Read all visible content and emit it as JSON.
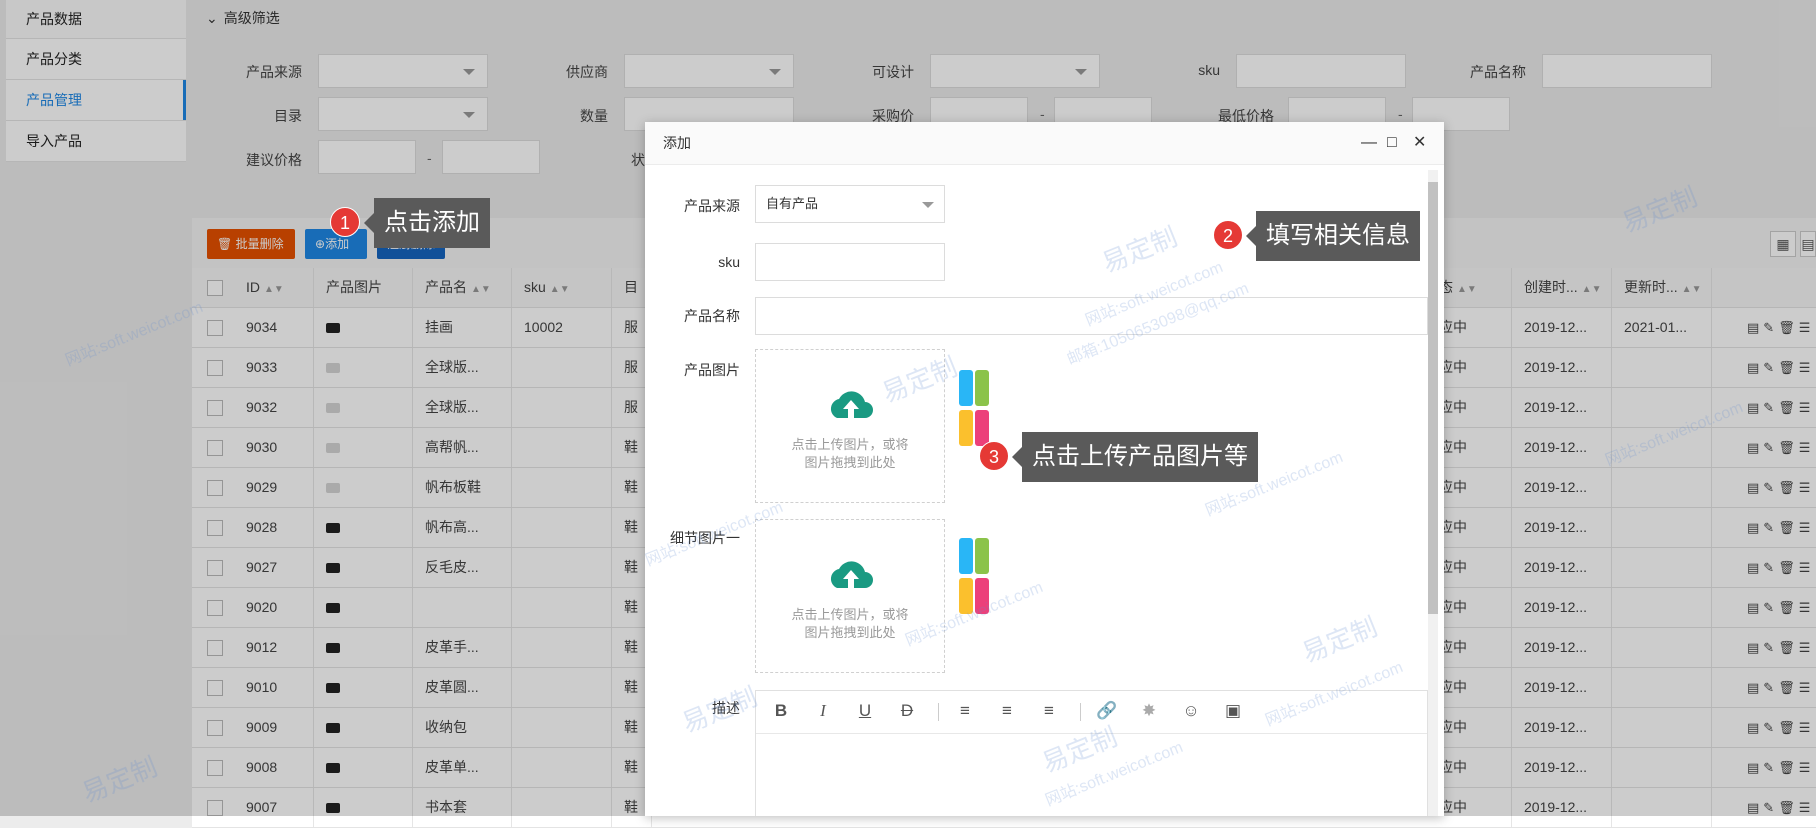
{
  "sidebar": {
    "items": [
      {
        "label": "产品数据"
      },
      {
        "label": "产品分类"
      },
      {
        "label": "产品管理"
      },
      {
        "label": "导入产品"
      }
    ]
  },
  "filter": {
    "title": "高级筛选",
    "fields": {
      "source": "产品来源",
      "supplier": "供应商",
      "designable": "可设计",
      "sku": "sku",
      "name": "产品名称",
      "catalog": "目录",
      "quantity": "数量",
      "purchase_price": "采购价",
      "min_price": "最低价格",
      "suggest_price": "建议价格",
      "status_partial": "状"
    },
    "range_sep": "-"
  },
  "toolbar": {
    "batch_delete": "批量删除",
    "add": "添加",
    "register": "注册删除"
  },
  "table": {
    "headers": [
      "ID",
      "产品图片",
      "产品名",
      "sku",
      "目",
      "态",
      "创建时...",
      "更新时..."
    ],
    "rows": [
      {
        "id": "9034",
        "name": "挂画",
        "sku": "10002",
        "cat": "服",
        "status": "应中",
        "created": "2019-12...",
        "updated": "2021-01...",
        "thumb": "dark"
      },
      {
        "id": "9033",
        "name": "全球版...",
        "sku": "",
        "cat": "服",
        "status": "应中",
        "created": "2019-12...",
        "updated": "",
        "thumb": "light"
      },
      {
        "id": "9032",
        "name": "全球版...",
        "sku": "",
        "cat": "服",
        "status": "应中",
        "created": "2019-12...",
        "updated": "",
        "thumb": "light"
      },
      {
        "id": "9030",
        "name": "高帮帆...",
        "sku": "",
        "cat": "鞋",
        "status": "应中",
        "created": "2019-12...",
        "updated": "",
        "thumb": "light"
      },
      {
        "id": "9029",
        "name": "帆布板鞋",
        "sku": "",
        "cat": "鞋",
        "status": "应中",
        "created": "2019-12...",
        "updated": "",
        "thumb": "light"
      },
      {
        "id": "9028",
        "name": "帆布高...",
        "sku": "",
        "cat": "鞋",
        "status": "应中",
        "created": "2019-12...",
        "updated": "",
        "thumb": "dark"
      },
      {
        "id": "9027",
        "name": "反毛皮...",
        "sku": "",
        "cat": "鞋",
        "status": "应中",
        "created": "2019-12...",
        "updated": "",
        "thumb": "dark"
      },
      {
        "id": "9020",
        "name": "",
        "sku": "",
        "cat": "鞋",
        "status": "应中",
        "created": "2019-12...",
        "updated": "",
        "thumb": "dark"
      },
      {
        "id": "9012",
        "name": "皮革手...",
        "sku": "",
        "cat": "鞋",
        "status": "应中",
        "created": "2019-12...",
        "updated": "",
        "thumb": "dark"
      },
      {
        "id": "9010",
        "name": "皮革圆...",
        "sku": "",
        "cat": "鞋",
        "status": "应中",
        "created": "2019-12...",
        "updated": "",
        "thumb": "dark"
      },
      {
        "id": "9009",
        "name": "收纳包",
        "sku": "",
        "cat": "鞋",
        "status": "应中",
        "created": "2019-12...",
        "updated": "",
        "thumb": "dark"
      },
      {
        "id": "9008",
        "name": "皮革单...",
        "sku": "",
        "cat": "鞋",
        "status": "应中",
        "created": "2019-12...",
        "updated": "",
        "thumb": "dark"
      },
      {
        "id": "9007",
        "name": "书本套",
        "sku": "",
        "cat": "鞋",
        "status": "应中",
        "created": "2019-12...",
        "updated": "",
        "thumb": "dark"
      }
    ]
  },
  "dialog": {
    "title": "添加",
    "fields": {
      "source_label": "产品来源",
      "source_value": "自有产品",
      "sku_label": "sku",
      "name_label": "产品名称",
      "image_label": "产品图片",
      "detail_label": "细节图片一",
      "desc_label": "描述"
    },
    "upload_hint_1": "点击上传图片，或将",
    "upload_hint_2": "图片拖拽到此处",
    "editor_tools": [
      "B",
      "I",
      "U",
      "D"
    ]
  },
  "callouts": [
    {
      "num": "1",
      "text": "点击添加"
    },
    {
      "num": "2",
      "text": "填写相关信息"
    },
    {
      "num": "3",
      "text": "点击上传产品图片等"
    }
  ],
  "watermark": {
    "brand": "易定制",
    "site": "网站:soft.weicot.com",
    "mail": "邮箱:1050653098@qq.com"
  },
  "colors": {
    "accent": "#1e88e5",
    "danger": "#e65100",
    "badge": "#e53935",
    "callout_bg": "#5a5a5a"
  }
}
